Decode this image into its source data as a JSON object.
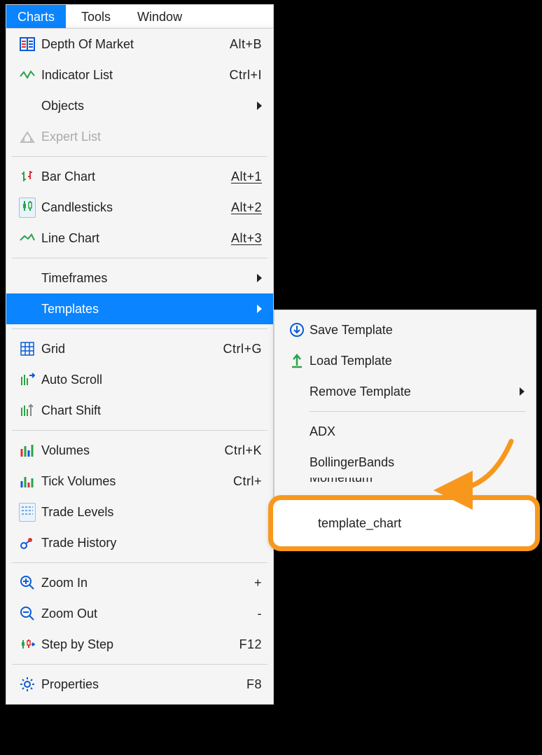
{
  "menubar": {
    "charts": "Charts",
    "tools": "Tools",
    "window": "Window"
  },
  "menu": {
    "depth_of_market": "Depth Of Market",
    "depth_of_market_sc": "Alt+B",
    "indicator_list": "Indicator List",
    "indicator_list_sc": "Ctrl+I",
    "objects": "Objects",
    "expert_list": "Expert List",
    "bar_chart": "Bar Chart",
    "bar_chart_sc": "Alt+1",
    "candlesticks": "Candlesticks",
    "candlesticks_sc": "Alt+2",
    "line_chart": "Line Chart",
    "line_chart_sc": "Alt+3",
    "timeframes": "Timeframes",
    "templates": "Templates",
    "grid": "Grid",
    "grid_sc": "Ctrl+G",
    "auto_scroll": "Auto Scroll",
    "chart_shift": "Chart Shift",
    "volumes": "Volumes",
    "volumes_sc": "Ctrl+K",
    "tick_volumes": "Tick Volumes",
    "tick_volumes_sc": "Ctrl+",
    "trade_levels": "Trade Levels",
    "trade_history": "Trade History",
    "zoom_in": "Zoom In",
    "zoom_in_sc": "+",
    "zoom_out": "Zoom Out",
    "zoom_out_sc": "-",
    "step_by_step": "Step by Step",
    "step_by_step_sc": "F12",
    "properties": "Properties",
    "properties_sc": "F8"
  },
  "submenu": {
    "save_template": "Save Template",
    "load_template": "Load Template",
    "remove_template": "Remove Template",
    "adx": "ADX",
    "bollinger": "BollingerBands",
    "momentum": "Momentum"
  },
  "callout": {
    "template_chart": "template_chart"
  }
}
